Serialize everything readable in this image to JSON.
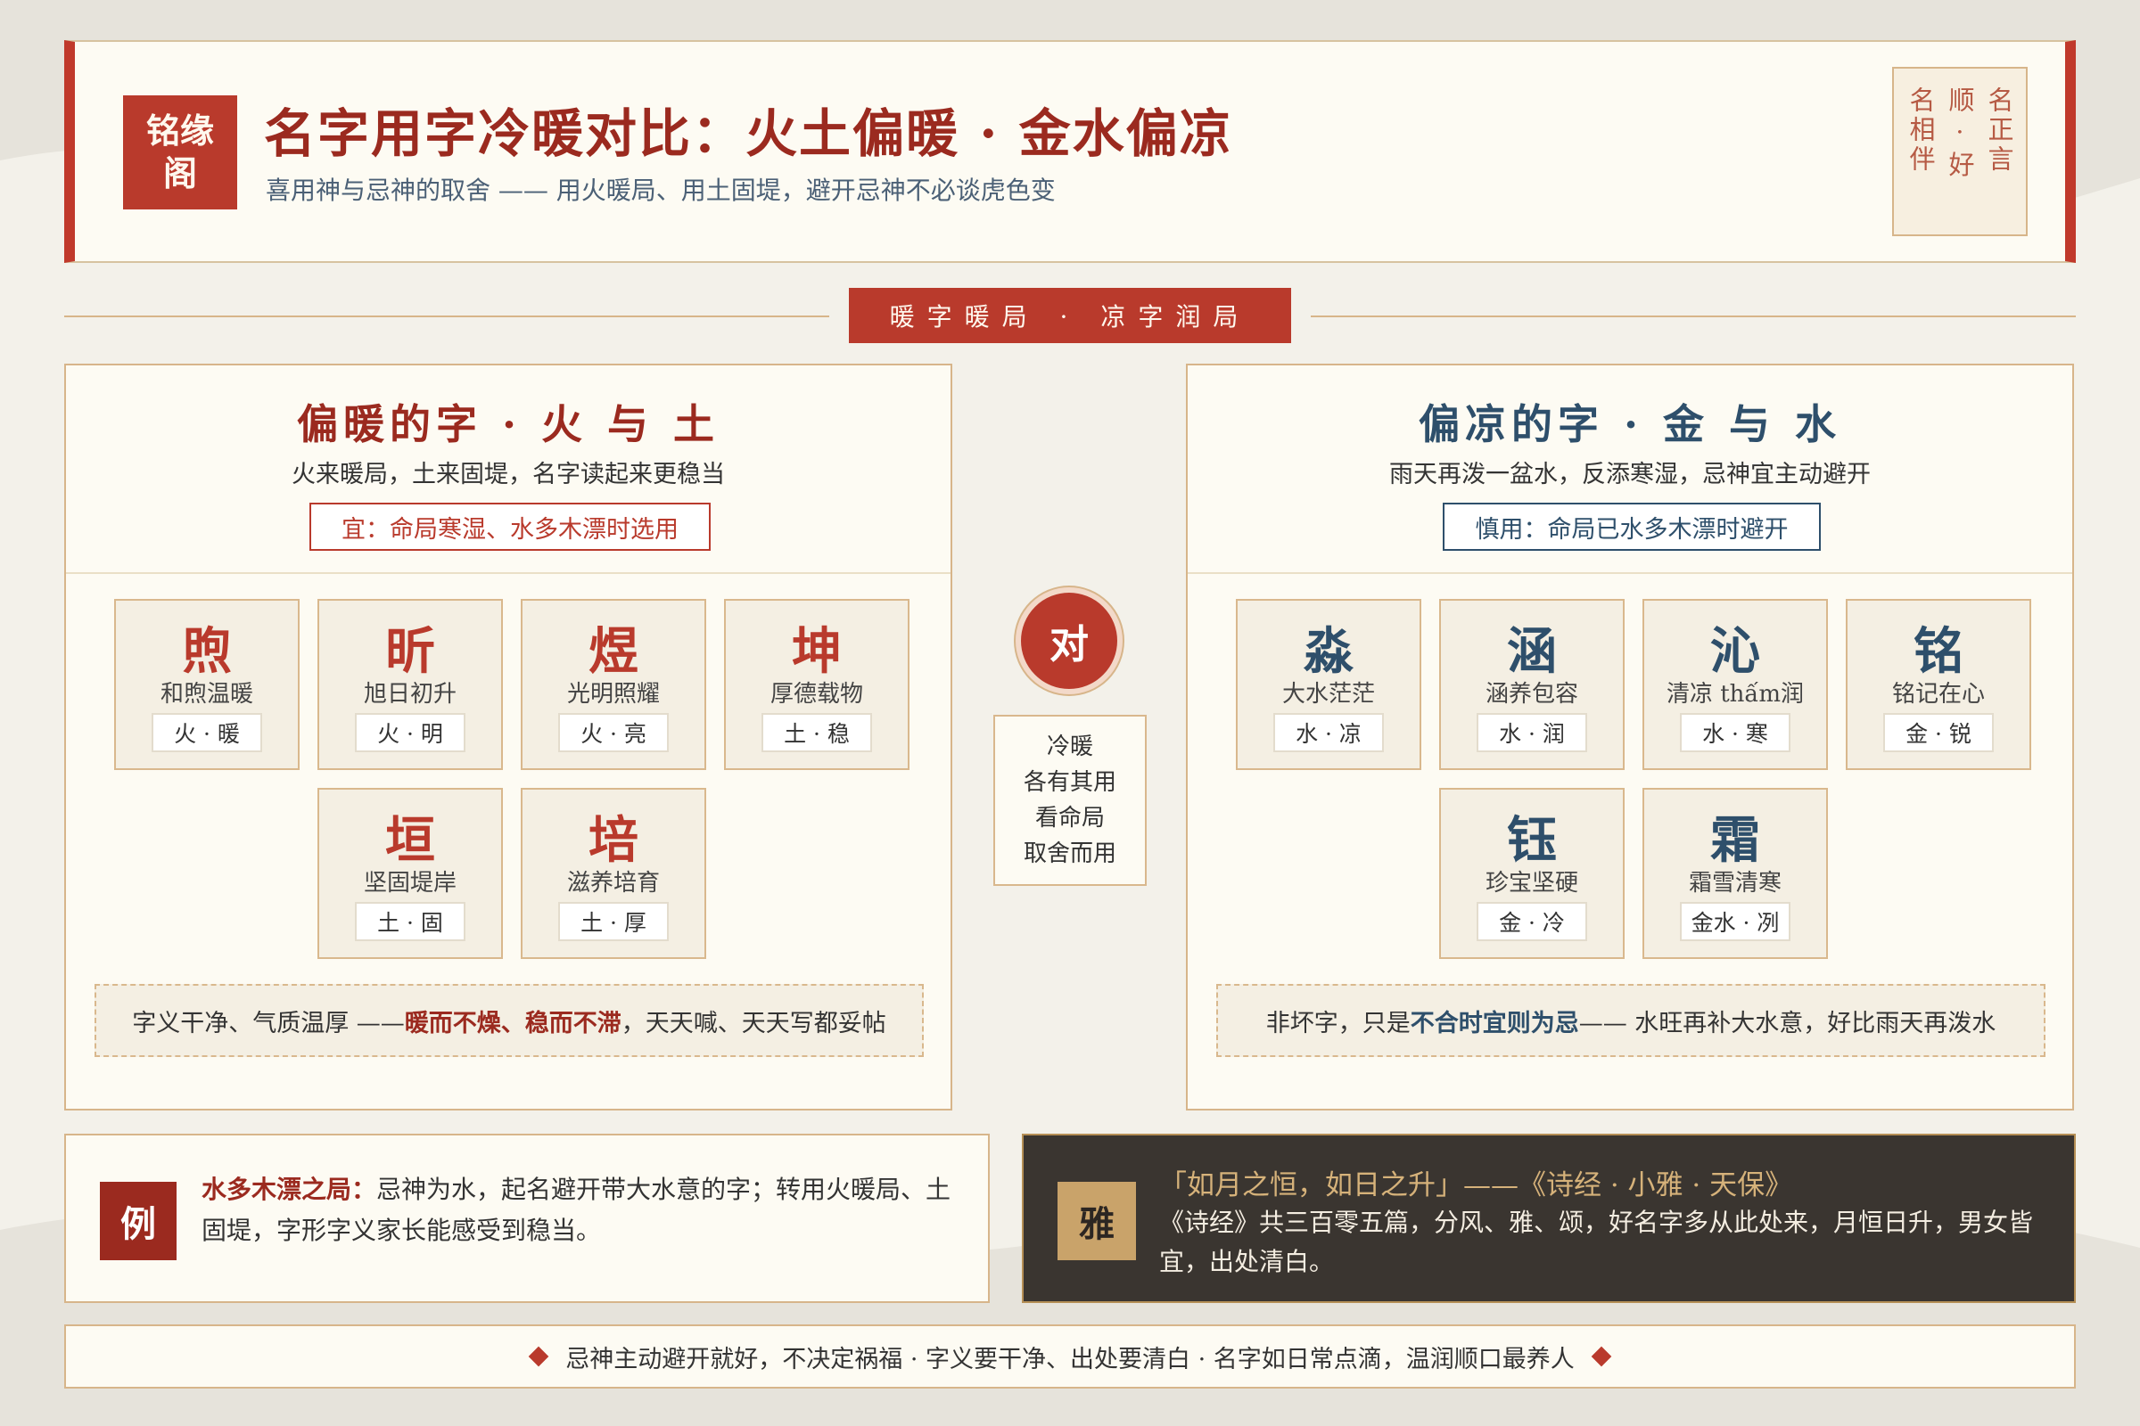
{
  "header": {
    "logo": "铭缘阁",
    "title": "名字用字冷暖对比：火土偏暖 · 金水偏凉",
    "subtitle": "喜用神与忌神的取舍 —— 用火暖局、用土固堤，避开忌神不必谈虎色变",
    "seal_columns": [
      "名正言",
      "顺 · 好",
      "名相伴"
    ]
  },
  "banner": {
    "label": "暖字暖局 · 凉字润局"
  },
  "warm": {
    "title": "偏暖的字 · 火 与 土",
    "desc": "火来暖局，土来固堤，名字读起来更稳当",
    "tag": "宜：命局寒湿、水多木漂时选用",
    "chars": [
      {
        "glyph": "煦",
        "meaning": "和煦温暖",
        "tag": "火 · 暖"
      },
      {
        "glyph": "昕",
        "meaning": "旭日初升",
        "tag": "火 · 明"
      },
      {
        "glyph": "煜",
        "meaning": "光明照耀",
        "tag": "火 · 亮"
      },
      {
        "glyph": "坤",
        "meaning": "厚德载物",
        "tag": "土 · 稳"
      },
      {
        "glyph": "垣",
        "meaning": "坚固堤岸",
        "tag": "土 · 固"
      },
      {
        "glyph": "培",
        "meaning": "滋养培育",
        "tag": "土 · 厚"
      }
    ],
    "note_pre": "字义干净、气质温厚 —— ",
    "note_strong": "暖而不燥、稳而不滞",
    "note_post": "，天天喊、天天写都妥帖"
  },
  "cool": {
    "title": "偏凉的字 · 金 与 水",
    "desc": "雨天再泼一盆水，反添寒湿，忌神宜主动避开",
    "tag": "慎用：命局已水多木漂时避开",
    "chars": [
      {
        "glyph": "淼",
        "meaning": "大水茫茫",
        "tag": "水 · 凉"
      },
      {
        "glyph": "涵",
        "meaning": "涵养包容",
        "tag": "水 · 润"
      },
      {
        "glyph": "沁",
        "meaning": "清凉 thấm润",
        "tag": "水 · 寒"
      },
      {
        "glyph": "铭",
        "meaning": "铭记在心",
        "tag": "金 · 锐"
      },
      {
        "glyph": "钰",
        "meaning": "珍宝坚硬",
        "tag": "金 · 冷"
      },
      {
        "glyph": "霜",
        "meaning": "霜雪清寒",
        "tag": "金水 · 冽"
      }
    ],
    "note_pre": "非坏字，只是",
    "note_strong": "不合时宜则为忌",
    "note_post": " —— 水旺再补大水意，好比雨天再泼水"
  },
  "center": {
    "vs": "对",
    "note_lines": [
      "冷暖",
      "各有其用",
      "看命局",
      "取舍而用"
    ]
  },
  "example": {
    "badge": "例",
    "label": "水多木漂之局：",
    "text": "忌神为水，起名避开带大水意的字；转用火暖局、土固堤，字形字义家长能感受到稳当。"
  },
  "quote": {
    "badge": "雅",
    "line1": "「如月之恒，如日之升」——《诗经 · 小雅 · 天保》",
    "line2": "《诗经》共三百零五篇，分风、雅、颂，好名字多从此处来，月恒日升，男女皆宜，出处清白。"
  },
  "footer": {
    "text": "忌神主动避开就好，不决定祸福 · 字义要干净、出处要清白 · 名字如日常点滴，温润顺口最养人"
  },
  "colors": {
    "accent_red": "#b93a2c",
    "cool_blue": "#2e4f6b",
    "gold": "#d7b58a"
  }
}
